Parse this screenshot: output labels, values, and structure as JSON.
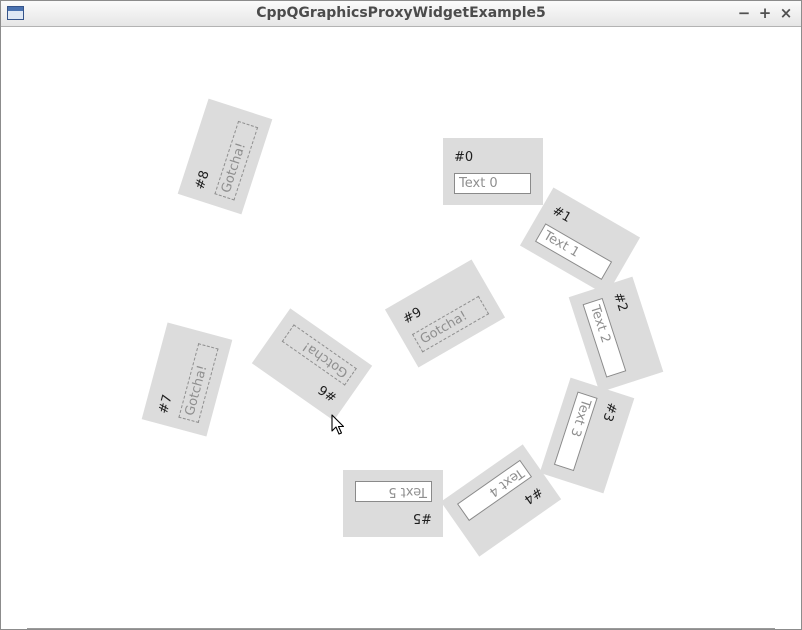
{
  "window": {
    "title": "CppQGraphicsProxyWidgetExample5",
    "controls": {
      "minimize": "−",
      "maximize": "+",
      "close": "×"
    }
  },
  "proxies": [
    {
      "label": "#0",
      "field": "Text 0"
    },
    {
      "label": "#1",
      "field": "Text 1"
    },
    {
      "label": "#2",
      "field": "Text 2"
    },
    {
      "label": "#3",
      "field": "Text 3"
    },
    {
      "label": "#4",
      "field": "Text 4"
    },
    {
      "label": "#5",
      "field": "Text 5"
    },
    {
      "label": "#6",
      "field": "Gotcha!"
    },
    {
      "label": "#7",
      "field": "Gotcha!"
    },
    {
      "label": "#8",
      "field": "Gotcha!"
    },
    {
      "label": "#9",
      "field": "Gotcha!"
    }
  ]
}
